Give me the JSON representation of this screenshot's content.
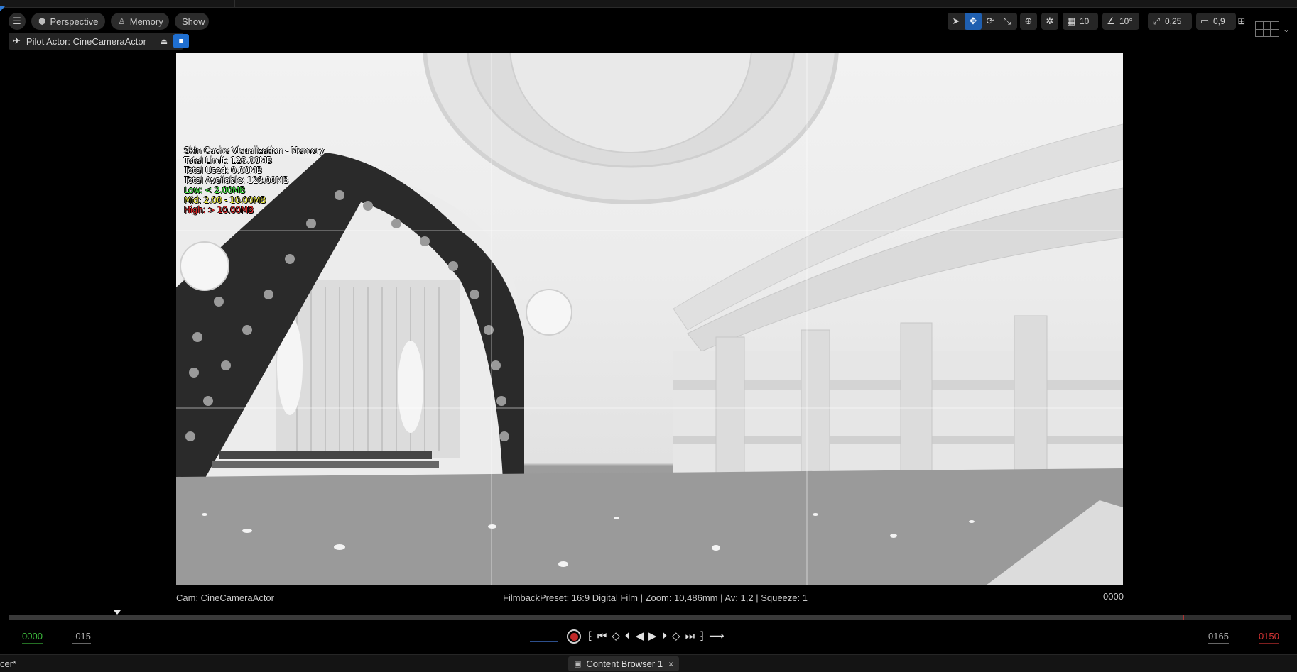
{
  "toolbar": {
    "menu_icon": "hamburger-icon",
    "perspective_label": "Perspective",
    "memory_label": "Memory",
    "show_label": "Show",
    "grid_snap_value": "10",
    "rotation_snap_value": "10°",
    "scale_snap_value": "0,25",
    "camera_speed_value": "0,9"
  },
  "pilot": {
    "label": "Pilot Actor: CineCameraActor"
  },
  "overlay": {
    "title": "Skin Cache Visualization - Memory",
    "total_limit": "Total Limit: 128.00MB",
    "total_used": "Total Used: 0.00MB",
    "total_available": "Total Available: 128.00MB",
    "low": "Low: < 2.00MB",
    "mid": "Mid: 2.00 - 10.00MB",
    "high": "High: > 10.00MB",
    "colors": {
      "low": "#2ecf2e",
      "mid": "#e6e62a",
      "high": "#e02020"
    }
  },
  "camera_info": {
    "cam_name": "Cam: CineCameraActor",
    "filmback": "FilmbackPreset: 16:9 Digital Film | Zoom: 10,486mm | Av: 1,2 | Squeeze: 1",
    "frame": "0000"
  },
  "timeline": {
    "start_frame": "0000",
    "view_start": "-015",
    "view_end": "0165",
    "end_frame": "0150"
  },
  "bottom": {
    "left_tab": "cer*",
    "content_browser_label": "Content Browser 1",
    "close_glyph": "×"
  }
}
